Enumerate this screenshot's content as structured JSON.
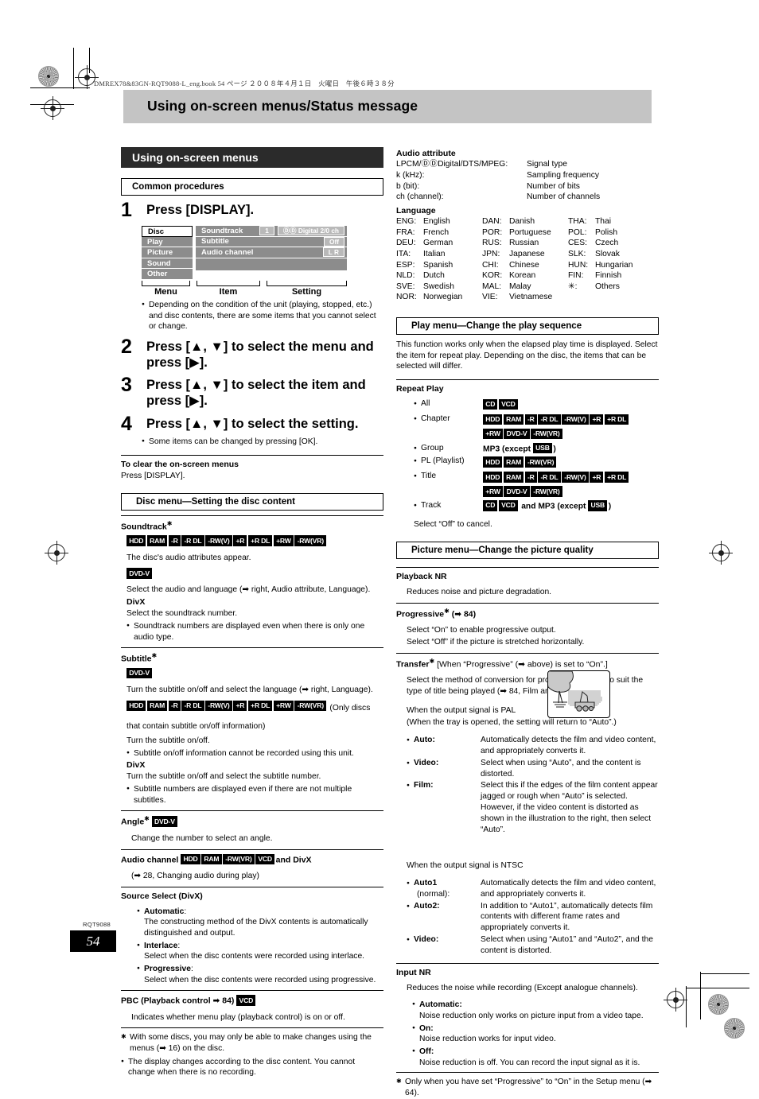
{
  "book_header": "DMREX78&83GN-RQT9088-L_eng.book   54 ページ   ２００８年４月１日　火曜日　午後６時３８分",
  "page_title": "Using on-screen menus/Status message",
  "footer": {
    "code": "RQT9088",
    "page_number": "54"
  },
  "left": {
    "section_title": "Using on-screen menus",
    "common_box": "Common procedures",
    "steps": [
      {
        "num": "1",
        "text": "Press [DISPLAY]."
      },
      {
        "num": "2",
        "text": "Press [▲, ▼] to select the menu and press [▶]."
      },
      {
        "num": "3",
        "text": "Press [▲, ▼] to select the item and press [▶]."
      },
      {
        "num": "4",
        "text": "Press [▲, ▼] to select the setting."
      }
    ],
    "osd": {
      "menus": [
        "Disc",
        "Play",
        "Picture",
        "Sound",
        "Other"
      ],
      "selected_menu": "Disc",
      "items": [
        {
          "name": "Soundtrack",
          "values": [
            "1",
            "ⒹⒹ Digital  2/0 ch"
          ]
        },
        {
          "name": "Subtitle",
          "values": [
            "Off"
          ]
        },
        {
          "name": "Audio channel",
          "values": [
            "L R"
          ]
        }
      ],
      "brace_labels": [
        "Menu",
        "Item",
        "Setting"
      ]
    },
    "note_step1": "Depending on the condition of the unit (playing, stopped, etc.) and disc contents, there are some items that you cannot select or change.",
    "note_step4": "Some items can be changed by pressing [OK].",
    "clear_heading": "To clear the on-screen menus",
    "clear_body": "Press [DISPLAY].",
    "disc_menu_box": "Disc menu—Setting the disc content",
    "soundtrack": {
      "heading": "Soundtrack",
      "tags_1": [
        "HDD",
        "RAM",
        "-R",
        "-R DL",
        "-RW(V)",
        "+R",
        "+R DL",
        "+RW",
        "-RW(VR)"
      ],
      "line_1": "The disc's audio attributes appear.",
      "tags_2": [
        "DVD-V"
      ],
      "line_2": "Select the audio and language (➡ right, Audio attribute, Language).",
      "label_divx": "DivX",
      "line_3": "Select the soundtrack number.",
      "bullet": "Soundtrack numbers are displayed even when there is only one audio type."
    },
    "subtitle": {
      "heading": "Subtitle",
      "tags_1": [
        "DVD-V"
      ],
      "line_1": "Turn the subtitle on/off and select the language (➡ right, Language).",
      "tags_2": [
        "HDD",
        "RAM",
        "-R",
        "-R DL",
        "-RW(V)",
        "+R",
        "+R DL",
        "+RW",
        "-RW(VR)"
      ],
      "tags_2_suffix": "(Only discs that contain subtitle on/off information)",
      "line_2": "Turn the subtitle on/off.",
      "bullet_1": "Subtitle on/off information cannot be recorded using this unit.",
      "label_divx": "DivX",
      "line_3": "Turn the subtitle on/off and select the subtitle number.",
      "bullet_2": "Subtitle numbers are displayed even if there are not multiple subtitles."
    },
    "angle": {
      "heading": "Angle",
      "tags": [
        "DVD-V"
      ],
      "body": "Change the number to select an angle."
    },
    "audio_channel": {
      "heading": "Audio channel",
      "tags": [
        "HDD",
        "RAM",
        "-RW(VR)",
        "VCD"
      ],
      "heading_suffix": "and DivX",
      "body": "(➡ 28, Changing audio during play)"
    },
    "source_select": {
      "heading": "Source Select (DivX)",
      "options": [
        {
          "term": "Automatic",
          "desc": "The constructing method of the DivX contents is automatically distinguished and output."
        },
        {
          "term": "Interlace",
          "desc": "Select when the disc contents were recorded using interlace."
        },
        {
          "term": "Progressive",
          "desc": "Select when the disc contents were recorded using progressive."
        }
      ]
    },
    "pbc": {
      "heading": "PBC (Playback control ➡ 84)",
      "tags": [
        "VCD"
      ],
      "body": "Indicates whether menu play (playback control) is on or off."
    },
    "footnote": "With some discs, you may only be able to make changes using the menus (➡ 16) on the disc.",
    "footnote_bullet": "The display changes according to the disc content. You cannot change when there is no recording."
  },
  "right": {
    "audio_attribute": {
      "heading": "Audio attribute",
      "rows": [
        {
          "a": "LPCM/ⒹⒹDigital/DTS/MPEG:",
          "b": "Signal type"
        },
        {
          "a": "k (kHz):",
          "b": "Sampling frequency"
        },
        {
          "a": "b (bit):",
          "b": "Number of bits"
        },
        {
          "a": "ch (channel):",
          "b": "Number of channels"
        }
      ]
    },
    "language": {
      "heading": "Language",
      "col1": [
        {
          "code": "ENG:",
          "name": "English"
        },
        {
          "code": "FRA:",
          "name": "French"
        },
        {
          "code": "DEU:",
          "name": "German"
        },
        {
          "code": "ITA:",
          "name": "Italian"
        },
        {
          "code": "ESP:",
          "name": "Spanish"
        },
        {
          "code": "NLD:",
          "name": "Dutch"
        },
        {
          "code": "SVE:",
          "name": "Swedish"
        },
        {
          "code": "NOR:",
          "name": "Norwegian"
        }
      ],
      "col2": [
        {
          "code": "DAN:",
          "name": "Danish"
        },
        {
          "code": "POR:",
          "name": "Portuguese"
        },
        {
          "code": "RUS:",
          "name": "Russian"
        },
        {
          "code": "JPN:",
          "name": "Japanese"
        },
        {
          "code": "CHI:",
          "name": "Chinese"
        },
        {
          "code": "KOR:",
          "name": "Korean"
        },
        {
          "code": "MAL:",
          "name": "Malay"
        },
        {
          "code": "VIE:",
          "name": "Vietnamese"
        }
      ],
      "col3": [
        {
          "code": "THA:",
          "name": "Thai"
        },
        {
          "code": "POL:",
          "name": "Polish"
        },
        {
          "code": "CES:",
          "name": "Czech"
        },
        {
          "code": "SLK:",
          "name": "Slovak"
        },
        {
          "code": "HUN:",
          "name": "Hungarian"
        },
        {
          "code": "FIN:",
          "name": "Finnish"
        },
        {
          "code": "✳:",
          "name": "Others"
        }
      ]
    },
    "play_menu_box": "Play menu—Change the play sequence",
    "play_menu_intro": "This function works only when the elapsed play time is displayed. Select the item for repeat play. Depending on the disc, the items that can be selected will differ.",
    "repeat_play": {
      "heading": "Repeat Play",
      "rows": [
        {
          "label": "All",
          "tags": [
            "CD",
            "VCD"
          ],
          "tags2": [],
          "pre": "",
          "mid": "",
          "post": ""
        },
        {
          "label": "Chapter",
          "tags": [
            "HDD",
            "RAM",
            "-R",
            "-R DL",
            "-RW(V)",
            "+R",
            "+R DL"
          ],
          "tags2": [
            "+RW",
            "DVD-V",
            "-RW(VR)"
          ],
          "pre": "",
          "mid": "",
          "post": ""
        },
        {
          "label": "Group",
          "tags": [
            "USB"
          ],
          "tags2": [],
          "pre": "MP3 (except",
          "mid": "",
          "post": ")"
        },
        {
          "label": "PL (Playlist)",
          "tags": [
            "HDD",
            "RAM",
            "-RW(VR)"
          ],
          "tags2": [],
          "pre": "",
          "mid": "",
          "post": ""
        },
        {
          "label": "Title",
          "tags": [
            "HDD",
            "RAM",
            "-R",
            "-R DL",
            "-RW(V)",
            "+R",
            "+R DL"
          ],
          "tags2": [
            "+RW",
            "DVD-V",
            "-RW(VR)"
          ],
          "pre": "",
          "mid": "",
          "post": ""
        },
        {
          "label": "Track",
          "tags": [
            "CD",
            "VCD"
          ],
          "tags2": [
            "USB"
          ],
          "pre": "",
          "mid": "and MP3 (except",
          "post": ")"
        }
      ],
      "cancel_note": "Select “Off” to cancel."
    },
    "picture_menu_box": "Picture menu—Change the picture quality",
    "playback_nr": {
      "heading": "Playback NR",
      "body": "Reduces noise and picture degradation."
    },
    "progressive": {
      "heading": "Progressive",
      "heading_suffix": "(➡ 84)",
      "line_1": "Select “On” to enable progressive output.",
      "line_2": "Select “Off” if the picture is stretched horizontally."
    },
    "transfer": {
      "heading": "Transfer",
      "heading_suffix": "[When “Progressive” (➡ above) is set to “On”.]",
      "intro": "Select the method of conversion for progressive output to suit the type of title being played (➡ 84, Film and video).",
      "pal_heading_1": "When the output signal is PAL",
      "pal_heading_2": "(When the tray is opened, the setting will return to “Auto”.)",
      "pal_options": [
        {
          "term": "Auto:",
          "desc": "Automatically detects the film and video content, and appropriately converts it."
        },
        {
          "term": "Video:",
          "desc": "Select when using “Auto”, and the content is distorted."
        },
        {
          "term": "Film:",
          "desc": "Select this if the edges of the film content appear jagged or rough when “Auto” is selected. However, if the video content is distorted as shown in the illustration to the right, then select “Auto”."
        }
      ],
      "ntsc_heading": "When the output signal is NTSC",
      "ntsc_options": [
        {
          "term": "Auto1",
          "term2": "(normal):",
          "desc": "Automatically detects the film and video content, and appropriately converts it."
        },
        {
          "term": "Auto2:",
          "term2": "",
          "desc": "In addition to “Auto1”, automatically detects film contents with different frame rates and appropriately converts it."
        },
        {
          "term": "Video:",
          "term2": "",
          "desc": "Select when using “Auto1” and “Auto2”, and the content is distorted."
        }
      ]
    },
    "input_nr": {
      "heading": "Input NR",
      "body": "Reduces the noise while recording (Except analogue channels).",
      "options": [
        {
          "term": "Automatic:",
          "desc": "Noise reduction only works on picture input from a video tape."
        },
        {
          "term": "On:",
          "desc": "Noise reduction works for input video."
        },
        {
          "term": "Off:",
          "desc": "Noise reduction is off. You can record the input signal as it is."
        }
      ]
    },
    "footnote": "Only when you have set “Progressive” to “On” in the Setup menu (➡ 64)."
  }
}
